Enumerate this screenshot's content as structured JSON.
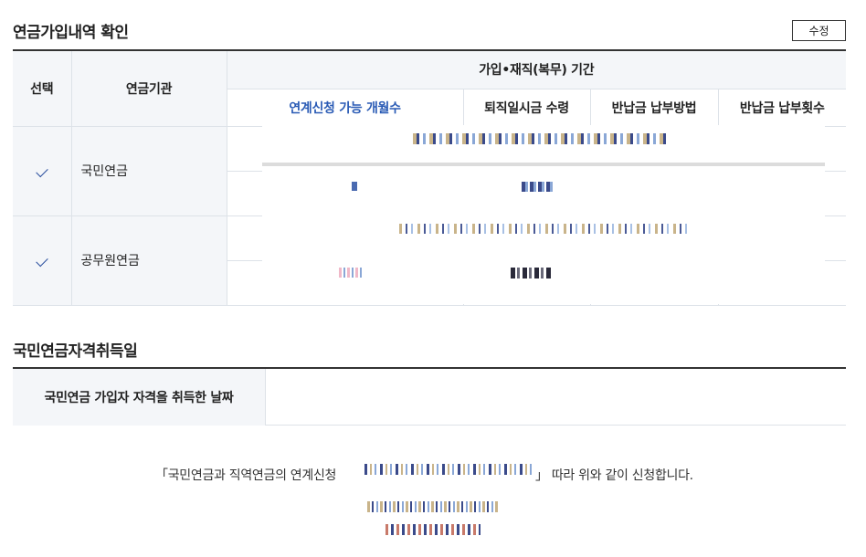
{
  "section1": {
    "title": "연금가입내역 확인",
    "edit_label": "수정"
  },
  "table": {
    "headers": {
      "select": "선택",
      "org": "연금기관",
      "period": "가입•재직(복무) 기간",
      "linkable_months": "연계신청 가능 개월수",
      "retirement_lump": "퇴직일시금 수령",
      "refund_method": "반납금 납부방법",
      "refund_count": "반납금 납부횟수"
    },
    "rows": [
      {
        "org": "국민연금",
        "selected": true
      },
      {
        "org": "공무원연금",
        "selected": true
      }
    ]
  },
  "section2": {
    "title": "국민연금자격취득일",
    "label": "국민연금 가입자 자격을 취득한 날짜"
  },
  "statement": {
    "pre": "「국민연금과 직역연금의 연계신청",
    "post": "」 따라 위와 같이 신청합니다."
  },
  "colors": {
    "accent_blue": "#2a5bb5",
    "header_bg": "#f4f6f9",
    "border": "#dde2e8"
  },
  "icons": {
    "check": "check-icon"
  }
}
